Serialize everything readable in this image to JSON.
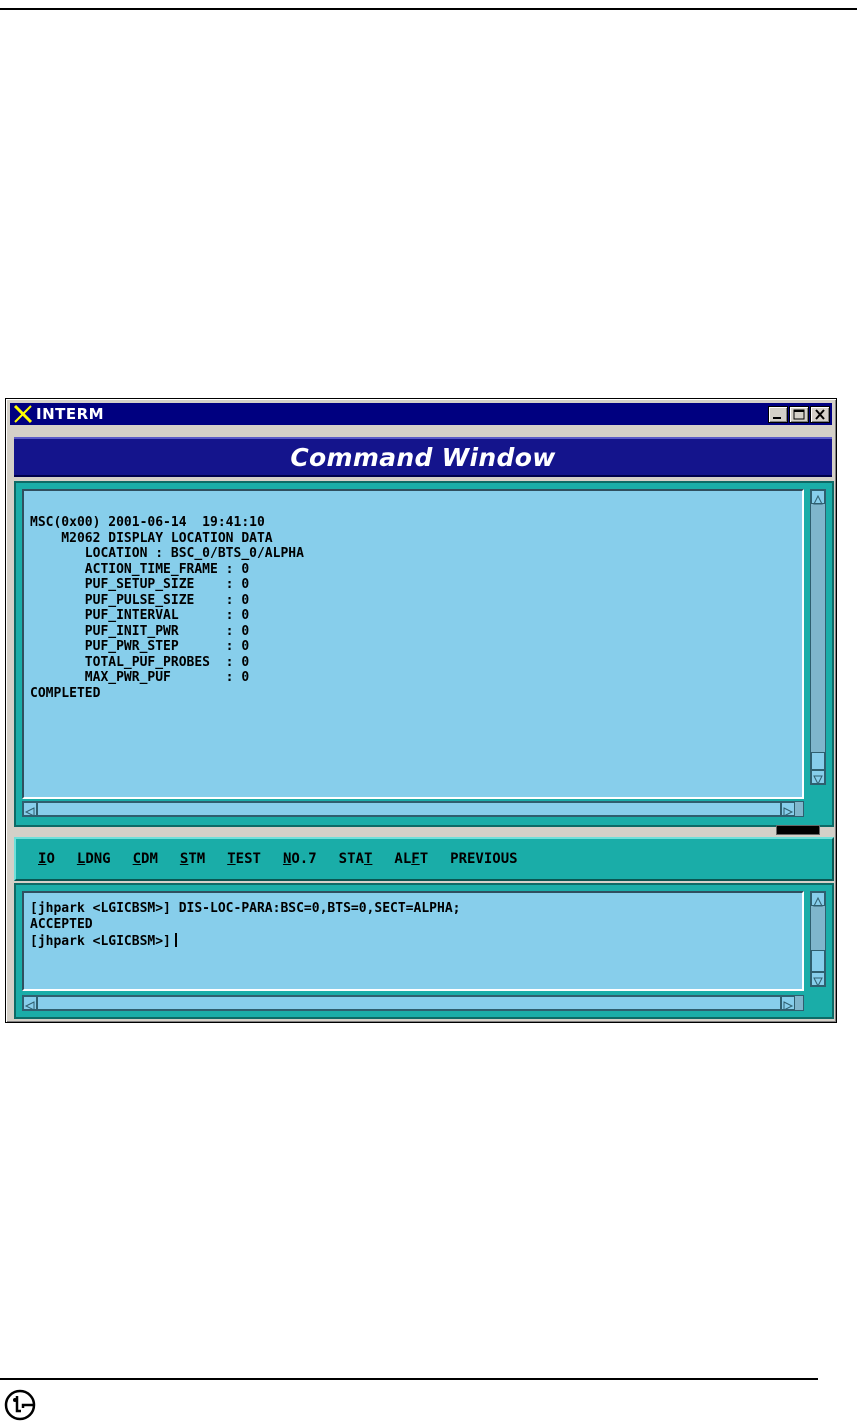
{
  "window": {
    "title": "INTERM",
    "header_title": "Command Window"
  },
  "output": {
    "lines": "MSC(0x00) 2001-06-14  19:41:10\n    M2062 DISPLAY LOCATION DATA\n       LOCATION : BSC_0/BTS_0/ALPHA\n       ACTION_TIME_FRAME : 0\n       PUF_SETUP_SIZE    : 0\n       PUF_PULSE_SIZE    : 0\n       PUF_INTERVAL      : 0\n       PUF_INIT_PWR      : 0\n       PUF_PWR_STEP      : 0\n       TOTAL_PUF_PROBES  : 0\n       MAX_PWR_PUF       : 0\nCOMPLETED"
  },
  "menu": {
    "items": [
      {
        "first": "I",
        "rest": "O"
      },
      {
        "first": "L",
        "rest": "DNG"
      },
      {
        "first": "C",
        "rest": "DM"
      },
      {
        "first": "S",
        "rest": "TM"
      },
      {
        "first": "T",
        "rest": "EST"
      },
      {
        "first": "N",
        "rest": "O.7"
      },
      {
        "pre": "STA",
        "mid": "T",
        "post": ""
      },
      {
        "pre": "AL",
        "mid": "F",
        "post": "T"
      },
      {
        "pre": "PREVIOUS",
        "mid": "",
        "post": ""
      }
    ]
  },
  "input": {
    "line1": "[jhpark <LGICBSM>] DIS-LOC-PARA:BSC=0,BTS=0,SECT=ALPHA;",
    "line2": "ACCEPTED",
    "line3": "[jhpark <LGICBSM>]"
  },
  "icons": {
    "app": "x-logo-icon",
    "minimize": "minimize-icon",
    "maximize": "maximize-icon",
    "close": "close-icon",
    "brand": "lg-logo-icon"
  }
}
